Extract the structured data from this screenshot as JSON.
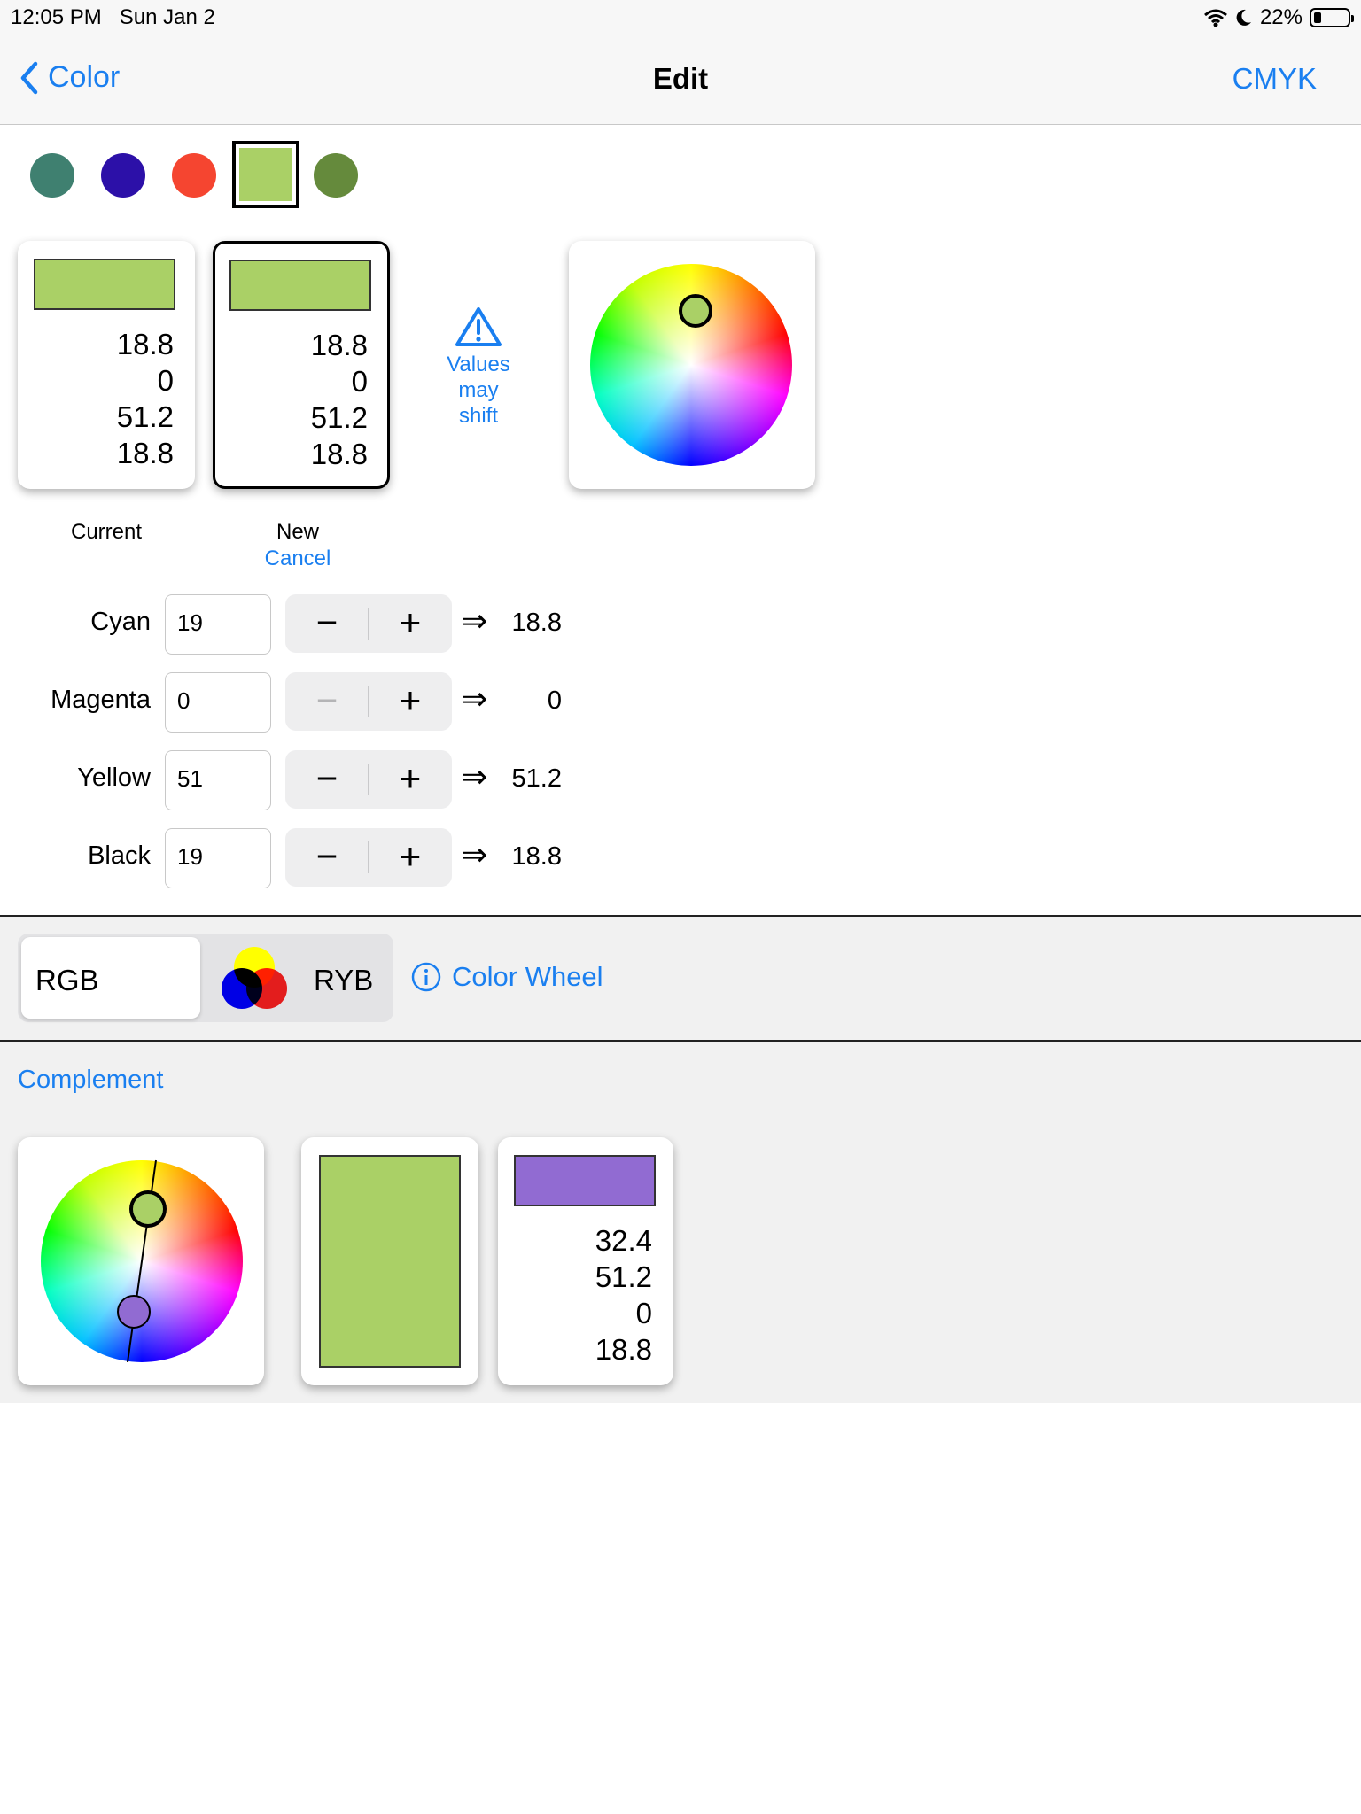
{
  "status_bar": {
    "time": "12:05 PM",
    "date": "Sun Jan 2",
    "battery": "22%"
  },
  "nav": {
    "back_label": "Color",
    "title": "Edit",
    "right_label": "CMYK"
  },
  "palette": [
    {
      "color": "#3f8070"
    },
    {
      "color": "#2c10a8"
    },
    {
      "color": "#f54530"
    },
    {
      "color": "#aad066",
      "selected": true
    },
    {
      "color": "#658a3c"
    }
  ],
  "current_card": {
    "swatch": "#aad066",
    "values": [
      "18.8",
      "0",
      "51.2",
      "18.8"
    ],
    "label": "Current"
  },
  "new_card": {
    "swatch": "#aad066",
    "values": [
      "18.8",
      "0",
      "51.2",
      "18.8"
    ],
    "label": "New",
    "cancel": "Cancel"
  },
  "warning": {
    "line1": "Values",
    "line2": "may",
    "line3": "shift",
    "icon": "warning-triangle-icon"
  },
  "rows": [
    {
      "label": "Cyan",
      "input": "19",
      "result": "18.8",
      "minus_enabled": true
    },
    {
      "label": "Magenta",
      "input": "0",
      "result": "0",
      "minus_enabled": false
    },
    {
      "label": "Yellow",
      "input": "51",
      "result": "51.2",
      "minus_enabled": true
    },
    {
      "label": "Black",
      "input": "19",
      "result": "18.8",
      "minus_enabled": true
    }
  ],
  "stepper": {
    "minus": "−",
    "plus": "+",
    "arrow": "⇒"
  },
  "mode": {
    "rgb_label": "RGB",
    "ryb_label": "RYB",
    "selected": "RGB",
    "info_label": "Color Wheel"
  },
  "complement": {
    "title": "Complement",
    "base_swatch": "#aad066",
    "complement_swatch": "#916bd2",
    "values": [
      "32.4",
      "51.2",
      "0",
      "18.8"
    ]
  }
}
